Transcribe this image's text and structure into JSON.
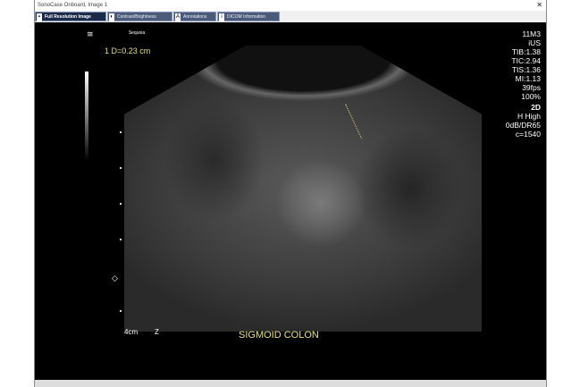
{
  "window": {
    "title": "SonoCase Onboard, Image 1",
    "close_label": "✕"
  },
  "tabs": [
    {
      "label": "Full Resolution Image",
      "icon": "image-icon",
      "active": true
    },
    {
      "label": "Contrast/Brightness",
      "icon": "contrast-icon",
      "active": false
    },
    {
      "label": "Annotations",
      "icon": "annotation-icon",
      "active": false
    },
    {
      "label": "DICOM Information",
      "icon": "info-icon",
      "active": false
    }
  ],
  "image": {
    "logo": "Sequoia",
    "measurement": "1  D=0.23 cm",
    "depth": "4cm",
    "focus_marker": "Z",
    "label": "SIGMOID COLON",
    "params": [
      "11M3",
      "iUS",
      "TIB:1.38",
      "TIC:2.94",
      "TIS:1.36",
      "MI:1.13",
      "39fps",
      "100%"
    ],
    "mode": "2D",
    "params2": [
      "H High",
      "0dB/DR65",
      "c=1540"
    ],
    "label_color": "#e6e07a"
  }
}
